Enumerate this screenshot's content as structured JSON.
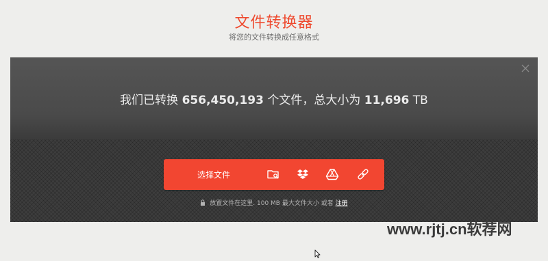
{
  "header": {
    "title": "文件转换器",
    "subtitle": "将您的文件转换成任意格式"
  },
  "stats": {
    "prefix": "我们已转换",
    "files_count": "656,450,193",
    "middle": "个文件，总大小为",
    "total_size": "11,696",
    "unit": "TB"
  },
  "uploader": {
    "choose_label": "选择文件",
    "sources": [
      "folder-search-icon",
      "dropbox-icon",
      "google-drive-icon",
      "link-icon"
    ],
    "hint_text": "放置文件在这里. 100 MB 最大文件大小 或者",
    "hint_link": "注册"
  },
  "watermark": "www.rjtj.cn软荐网",
  "colors": {
    "accent": "#f24631",
    "title": "#ee4a2f",
    "panel": "#3d3d3d"
  }
}
